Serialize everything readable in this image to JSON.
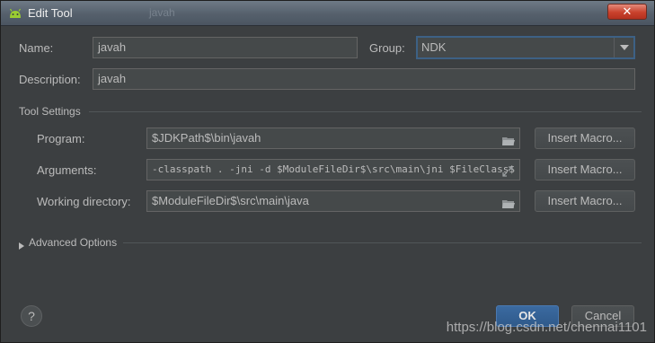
{
  "window": {
    "title": "Edit Tool",
    "ghost_tab": "javah",
    "close_label": "✕"
  },
  "form": {
    "name_label": "Name:",
    "name_value": "javah",
    "group_label": "Group:",
    "group_value": "NDK",
    "description_label": "Description:",
    "description_value": "javah"
  },
  "tool_settings": {
    "title": "Tool Settings",
    "program_label": "Program:",
    "program_value": "$JDKPath$\\bin\\javah",
    "arguments_label": "Arguments:",
    "arguments_value": "-classpath . -jni -d $ModuleFileDir$\\src\\main\\jni $FileClass$",
    "workdir_label": "Working directory:",
    "workdir_value": "$ModuleFileDir$\\src\\main\\java",
    "insert_macro_label": "Insert Macro..."
  },
  "advanced": {
    "label": "Advanced Options"
  },
  "footer": {
    "help_label": "?",
    "ok_label": "OK",
    "cancel_label": "Cancel",
    "watermark": "https://blog.csdn.net/chennai1101"
  },
  "colors": {
    "accent": "#3d6185",
    "background": "#3c3f41",
    "field": "#45494a",
    "text": "#bbbbbb"
  }
}
